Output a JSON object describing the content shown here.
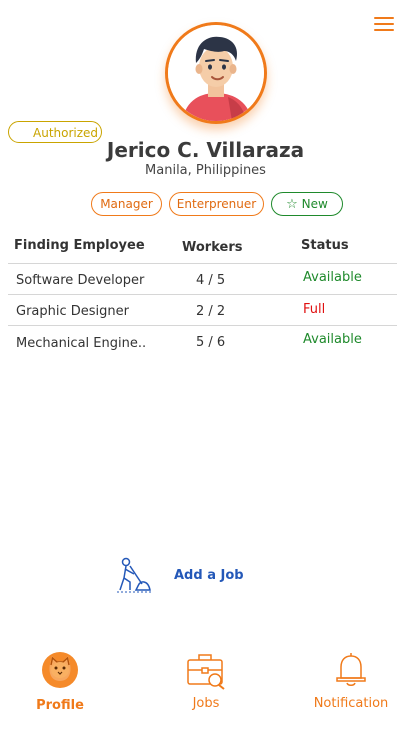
{
  "header": {
    "menu_icon": "hamburger-menu-icon"
  },
  "profile": {
    "badge": "Authorized",
    "name": "Jerico C. Villaraza",
    "location": "Manila, Philippines",
    "tags": [
      "Manager",
      "Enterprenuer"
    ],
    "new_tag": "New"
  },
  "table": {
    "headers": [
      "Finding Employee",
      "Workers",
      "Status"
    ],
    "rows": [
      {
        "position": "Software Developer",
        "workers": "4 / 5",
        "status": "Available"
      },
      {
        "position": "Graphic Designer",
        "workers": "2 / 2",
        "status": "Full"
      },
      {
        "position": "Mechanical Engine..",
        "workers": "5 / 6",
        "status": "Available"
      }
    ]
  },
  "add_job": {
    "label": "Add a Job"
  },
  "nav": {
    "profile": "Profile",
    "jobs": "Jobs",
    "notification": "Notification"
  },
  "colors": {
    "accent": "#f07a1a",
    "available": "#1f8a2c",
    "full": "#e01010",
    "link": "#2458b8",
    "authorized": "#c9a400"
  }
}
